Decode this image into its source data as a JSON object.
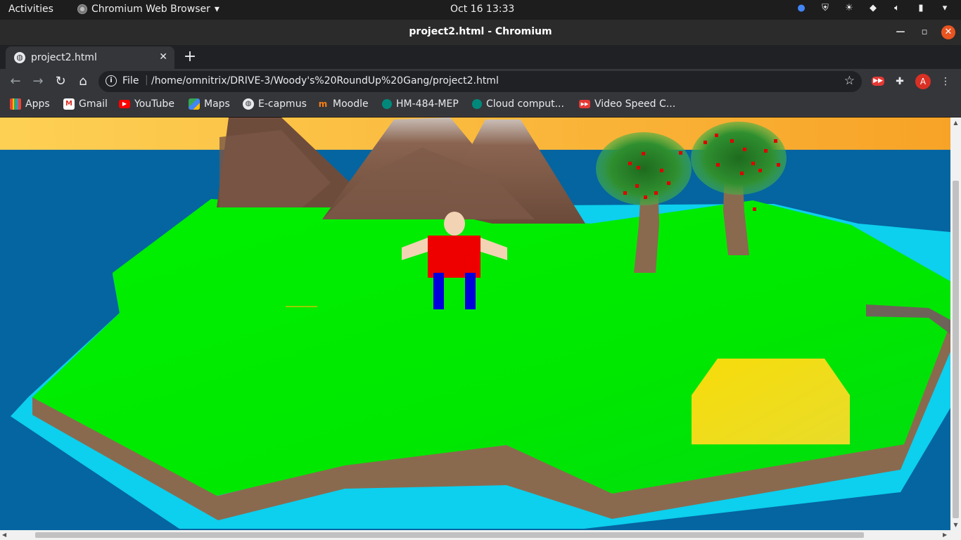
{
  "system_bar": {
    "activities": "Activities",
    "app_name": "Chromium Web Browser",
    "clock": "Oct 16  13:33"
  },
  "window": {
    "title": "project2.html - Chromium"
  },
  "tab": {
    "label": "project2.html"
  },
  "omnibox": {
    "scheme": "File",
    "url": "/home/omnitrix/DRIVE-3/Woody's%20RoundUp%20Gang/project2.html"
  },
  "profile": {
    "initial": "A"
  },
  "bookmarks": {
    "items": [
      {
        "label": "Apps",
        "icon": "apps-grid-icon"
      },
      {
        "label": "Gmail",
        "icon": "gmail-icon"
      },
      {
        "label": "YouTube",
        "icon": "youtube-icon"
      },
      {
        "label": "Maps",
        "icon": "maps-icon"
      },
      {
        "label": "E-capmus",
        "icon": "globe-icon"
      },
      {
        "label": "Moodle",
        "icon": "moodle-icon"
      },
      {
        "label": "HM-484-MEP",
        "icon": "meet-icon"
      },
      {
        "label": "Cloud comput...",
        "icon": "meet-icon"
      },
      {
        "label": "Video Speed C...",
        "icon": "video-speed-icon"
      }
    ]
  },
  "scene": {
    "sky_color": "#f9b53a",
    "water_color": "#0465a0",
    "shallow_color": "#0dcfee",
    "grass_color": "#00ee00",
    "dirt_color": "#8a6a4e",
    "sand_color": "#f0dc10",
    "shirt_color": "#ee0000",
    "pants_color": "#0000dd",
    "skin_color": "#f2d3b3"
  }
}
